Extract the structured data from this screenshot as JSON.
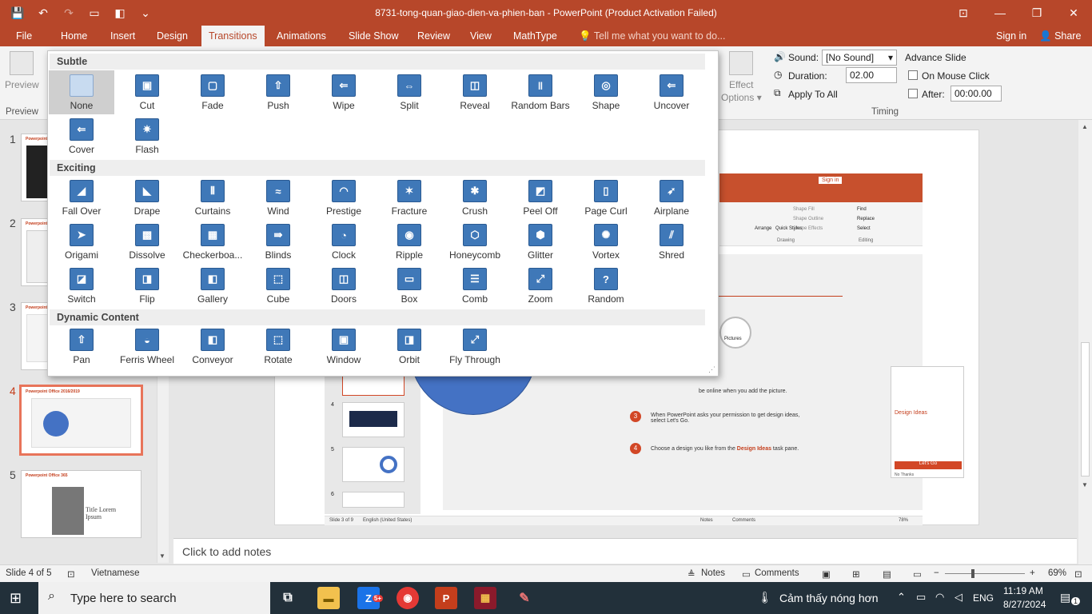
{
  "window": {
    "title": "8731-tong-quan-giao-dien-va-phien-ban - PowerPoint (Product Activation Failed)",
    "qat": [
      {
        "name": "save-icon",
        "glyph": "💾"
      },
      {
        "name": "undo-icon",
        "glyph": "↶"
      },
      {
        "name": "redo-icon",
        "glyph": "↷"
      },
      {
        "name": "present-icon",
        "glyph": "▭"
      },
      {
        "name": "layout-icon",
        "glyph": "◧"
      },
      {
        "name": "customize-icon",
        "glyph": "⌄"
      }
    ],
    "buttons": {
      "restore_ribbon": "⊡",
      "minimize": "—",
      "maximize": "❐",
      "close": "✕"
    }
  },
  "tabs": [
    "File",
    "Home",
    "Insert",
    "Design",
    "Transitions",
    "Animations",
    "Slide Show",
    "Review",
    "View",
    "MathType"
  ],
  "active_tab": "Transitions",
  "tell_me": "Tell me what you want to do...",
  "sign_in": "Sign in",
  "share": "Share",
  "ribbon": {
    "preview_label": "Preview",
    "preview_group": "Preview",
    "effect_options_1": "Effect",
    "effect_options_2": "Options ▾",
    "sound_label": "Sound:",
    "sound_value": "[No Sound]",
    "duration_label": "Duration:",
    "duration_value": "02.00",
    "apply_all": "Apply To All",
    "advance_slide": "Advance Slide",
    "on_mouse_click": "On Mouse Click",
    "after_label": "After:",
    "after_value": "00:00.00",
    "timing_group": "Timing"
  },
  "gallery": {
    "sections": [
      {
        "title": "Subtle",
        "items": [
          {
            "label": "None",
            "g": ""
          },
          {
            "label": "Cut",
            "g": "▣"
          },
          {
            "label": "Fade",
            "g": "▢"
          },
          {
            "label": "Push",
            "g": "⇧"
          },
          {
            "label": "Wipe",
            "g": "⇐"
          },
          {
            "label": "Split",
            "g": "⇔"
          },
          {
            "label": "Reveal",
            "g": "◫"
          },
          {
            "label": "Random Bars",
            "g": "‖"
          },
          {
            "label": "Shape",
            "g": "◎"
          },
          {
            "label": "Uncover",
            "g": "⇐"
          },
          {
            "label": "Cover",
            "g": "⇐"
          },
          {
            "label": "Flash",
            "g": "✷"
          }
        ]
      },
      {
        "title": "Exciting",
        "items": [
          {
            "label": "Fall Over",
            "g": "◢"
          },
          {
            "label": "Drape",
            "g": "◣"
          },
          {
            "label": "Curtains",
            "g": "⫴"
          },
          {
            "label": "Wind",
            "g": "≈"
          },
          {
            "label": "Prestige",
            "g": "◠"
          },
          {
            "label": "Fracture",
            "g": "✶"
          },
          {
            "label": "Crush",
            "g": "✱"
          },
          {
            "label": "Peel Off",
            "g": "◩"
          },
          {
            "label": "Page Curl",
            "g": "▯"
          },
          {
            "label": "Airplane",
            "g": "➶"
          },
          {
            "label": "Origami",
            "g": "➤"
          },
          {
            "label": "Dissolve",
            "g": "▩"
          },
          {
            "label": "Checkerboa...",
            "g": "▦"
          },
          {
            "label": "Blinds",
            "g": "⇛"
          },
          {
            "label": "Clock",
            "g": "◔"
          },
          {
            "label": "Ripple",
            "g": "◉"
          },
          {
            "label": "Honeycomb",
            "g": "⬡"
          },
          {
            "label": "Glitter",
            "g": "⬢"
          },
          {
            "label": "Vortex",
            "g": "✺"
          },
          {
            "label": "Shred",
            "g": "⫽"
          },
          {
            "label": "Switch",
            "g": "◪"
          },
          {
            "label": "Flip",
            "g": "◨"
          },
          {
            "label": "Gallery",
            "g": "◧"
          },
          {
            "label": "Cube",
            "g": "⬚"
          },
          {
            "label": "Doors",
            "g": "◫"
          },
          {
            "label": "Box",
            "g": "▭"
          },
          {
            "label": "Comb",
            "g": "☰"
          },
          {
            "label": "Zoom",
            "g": "⤢"
          },
          {
            "label": "Random",
            "g": "?"
          }
        ]
      },
      {
        "title": "Dynamic Content",
        "items": [
          {
            "label": "Pan",
            "g": "⇧"
          },
          {
            "label": "Ferris Wheel",
            "g": "◒"
          },
          {
            "label": "Conveyor",
            "g": "◧"
          },
          {
            "label": "Rotate",
            "g": "⬚"
          },
          {
            "label": "Window",
            "g": "▣"
          },
          {
            "label": "Orbit",
            "g": "◨"
          },
          {
            "label": "Fly Through",
            "g": "⤢"
          }
        ]
      }
    ]
  },
  "thumbnails": [
    {
      "num": "1",
      "title": "Powerpoint Office"
    },
    {
      "num": "2",
      "title": "Powerpoint Office"
    },
    {
      "num": "3",
      "title": "Powerpoint Office"
    },
    {
      "num": "4",
      "title": "Powerpoint Office 2016/2019"
    },
    {
      "num": "5",
      "title": "Powerpoint Office 365",
      "body1": "Title Lorem",
      "body2": "Ipsum"
    }
  ],
  "inner_slide": {
    "sign_in": "Sign in",
    "drawing_group": "Drawing",
    "editing_group": "Editing",
    "find": "Find",
    "replace": "Replace",
    "select": "Select",
    "shape_fill": "Shape Fill",
    "shape_outline": "Shape Outline",
    "shape_effects": "Shape Effects",
    "arrange": "Arrange",
    "quick_styles": "Quick Styles",
    "pictures": "Pictures",
    "step_text": "be online when you add the picture.",
    "step3": "When PowerPoint asks your permission to get design ideas, select Let's Go.",
    "step4_pre": "Choose a design you like from the ",
    "step4_link": "Design Ideas",
    "step4_post": " task pane.",
    "design_ideas": "Design Ideas",
    "lets_go": "Let's Go",
    "no_thanks": "No Thanks",
    "status_slide": "Slide 3 of 9",
    "status_lang": "English (United States)",
    "notes": "Notes",
    "comments": "Comments",
    "zoom": "78%",
    "nums": [
      "4",
      "5",
      "6"
    ]
  },
  "notes_placeholder": "Click to add notes",
  "status": {
    "slide": "Slide 4 of 5",
    "language": "Vietnamese",
    "notes": "Notes",
    "comments": "Comments",
    "zoom": "69%"
  },
  "taskbar": {
    "search": "Type here to search",
    "weather": "Cảm thấy nóng hơn",
    "lang": "ENG",
    "time": "11:19 AM",
    "date": "8/27/2024",
    "notify": "1",
    "zalo_badge": "5+"
  },
  "colors": {
    "accent": "#b7472a",
    "tile": "#3f78b8"
  }
}
